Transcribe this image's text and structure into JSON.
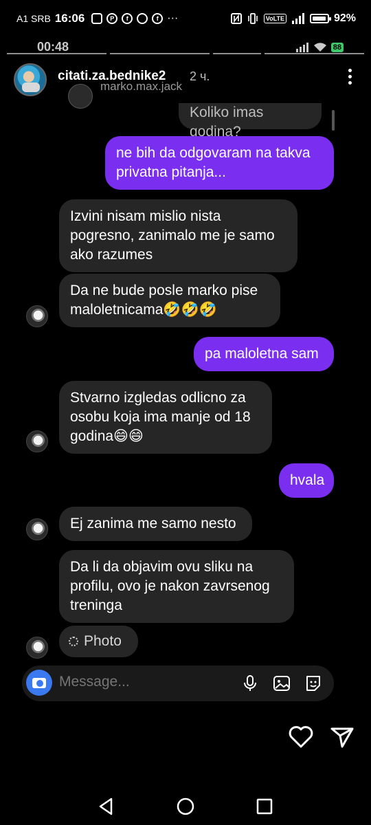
{
  "status_bar": {
    "carrier": "A1 SRB",
    "time": "16:06",
    "app_icons": [
      "instagram-icon",
      "pinterest-icon",
      "facebook-icon",
      "messenger-icon",
      "facebook-icon"
    ],
    "overflow": "···",
    "volte": "VoLTE",
    "battery": "92%"
  },
  "story": {
    "recorded_time": "00:48",
    "recorded_battery": "88",
    "username": "citati.za.bednike2",
    "time_ago": "2 ч.",
    "sub_user": "marko.max.jack"
  },
  "messages": [
    {
      "from": "them",
      "text": "Koliko imas godina?"
    },
    {
      "from": "me",
      "text": "ne bih da odgovaram na takva privatna pitanja..."
    },
    {
      "from": "them",
      "text": "Izvini nisam mislio nista pogresno, zanimalo me je samo ako razumes"
    },
    {
      "from": "them",
      "text": "Da ne bude posle marko pise maloletnicama🤣🤣🤣"
    },
    {
      "from": "me",
      "text": "pa maloletna sam"
    },
    {
      "from": "them",
      "text": "Stvarno izgledas odlicno za osobu koja ima manje od 18 godina😄😄"
    },
    {
      "from": "me",
      "text": "hvala"
    },
    {
      "from": "them",
      "text": "Ej zanima me samo nesto"
    },
    {
      "from": "them",
      "text": "Da li da objavim ovu sliku na profilu, ovo je nakon zavrsenog treninga"
    },
    {
      "from": "them",
      "text": "Photo"
    }
  ],
  "composer": {
    "placeholder": "Message..."
  },
  "colors": {
    "outgoing": "#7a2ff0",
    "incoming": "#262626",
    "camera": "#3a79f0"
  }
}
